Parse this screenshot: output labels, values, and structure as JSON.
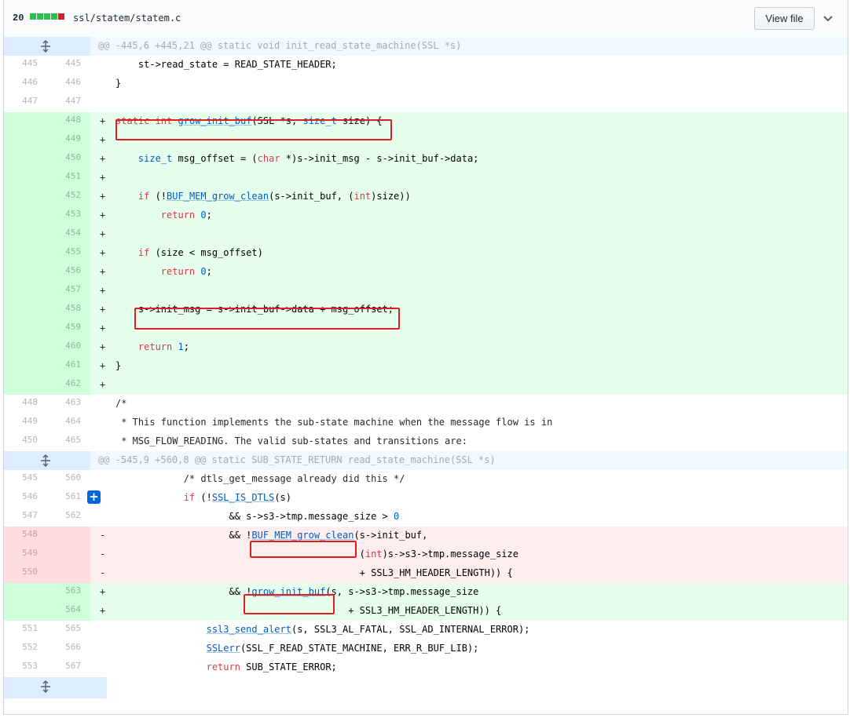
{
  "file": {
    "changes_count": "20",
    "diffstat_colors": [
      "#2cbe4e",
      "#2cbe4e",
      "#2cbe4e",
      "#2cbe4e",
      "#cb2431"
    ],
    "path": "ssl/statem/statem.c",
    "view_file_label": "View file",
    "collapse_icon": "chevron-down-icon",
    "expand_icon": "unfold-icon"
  },
  "hunks": [
    "@@ -445,6 +445,21 @@ static void init_read_state_machine(SSL *s)",
    "@@ -545,9 +560,8 @@ static SUB_STATE_RETURN read_state_machine(SSL *s)"
  ],
  "lines": [
    {
      "o": "445",
      "n": "445",
      "m": " ",
      "c": "    st->read_state = READ_STATE_HEADER;"
    },
    {
      "o": "446",
      "n": "446",
      "m": " ",
      "c": "}"
    },
    {
      "o": "447",
      "n": "447",
      "m": " ",
      "c": ""
    },
    {
      "o": "",
      "n": "448",
      "m": "+",
      "c": "static int grow_init_buf(SSL *s, size_t size) {"
    },
    {
      "o": "",
      "n": "449",
      "m": "+",
      "c": ""
    },
    {
      "o": "",
      "n": "450",
      "m": "+",
      "c": "    size_t msg_offset = (char *)s->init_msg - s->init_buf->data;"
    },
    {
      "o": "",
      "n": "451",
      "m": "+",
      "c": ""
    },
    {
      "o": "",
      "n": "452",
      "m": "+",
      "c": "    if (!BUF_MEM_grow_clean(s->init_buf, (int)size))"
    },
    {
      "o": "",
      "n": "453",
      "m": "+",
      "c": "        return 0;"
    },
    {
      "o": "",
      "n": "454",
      "m": "+",
      "c": ""
    },
    {
      "o": "",
      "n": "455",
      "m": "+",
      "c": "    if (size < msg_offset)"
    },
    {
      "o": "",
      "n": "456",
      "m": "+",
      "c": "        return 0;"
    },
    {
      "o": "",
      "n": "457",
      "m": "+",
      "c": ""
    },
    {
      "o": "",
      "n": "458",
      "m": "+",
      "c": "    s->init_msg = s->init_buf->data + msg_offset;"
    },
    {
      "o": "",
      "n": "459",
      "m": "+",
      "c": ""
    },
    {
      "o": "",
      "n": "460",
      "m": "+",
      "c": "    return 1;"
    },
    {
      "o": "",
      "n": "461",
      "m": "+",
      "c": "}"
    },
    {
      "o": "",
      "n": "462",
      "m": "+",
      "c": ""
    },
    {
      "o": "448",
      "n": "463",
      "m": " ",
      "c": "/*"
    },
    {
      "o": "449",
      "n": "464",
      "m": " ",
      "c": " * This function implements the sub-state machine when the message flow is in"
    },
    {
      "o": "450",
      "n": "465",
      "m": " ",
      "c": " * MSG_FLOW_READING. The valid sub-states and transitions are:"
    },
    {
      "o": "545",
      "n": "560",
      "m": " ",
      "c": "            /* dtls_get_message already did this */"
    },
    {
      "o": "546",
      "n": "561",
      "m": " ",
      "c": "            if (!SSL_IS_DTLS(s)"
    },
    {
      "o": "547",
      "n": "562",
      "m": " ",
      "c": "                    && s->s3->tmp.message_size > 0"
    },
    {
      "o": "548",
      "n": "",
      "m": "-",
      "c": "                    && !BUF_MEM_grow_clean(s->init_buf,"
    },
    {
      "o": "549",
      "n": "",
      "m": "-",
      "c": "                                           (int)s->s3->tmp.message_size"
    },
    {
      "o": "550",
      "n": "",
      "m": "-",
      "c": "                                           + SSL3_HM_HEADER_LENGTH)) {"
    },
    {
      "o": "",
      "n": "563",
      "m": "+",
      "c": "                    && !grow_init_buf(s, s->s3->tmp.message_size"
    },
    {
      "o": "",
      "n": "564",
      "m": "+",
      "c": "                                         + SSL3_HM_HEADER_LENGTH)) {"
    },
    {
      "o": "551",
      "n": "565",
      "m": " ",
      "c": "                ssl3_send_alert(s, SSL3_AL_FATAL, SSL_AD_INTERNAL_ERROR);"
    },
    {
      "o": "552",
      "n": "566",
      "m": " ",
      "c": "                SSLerr(SSL_F_READ_STATE_MACHINE, ERR_R_BUF_LIB);"
    },
    {
      "o": "553",
      "n": "567",
      "m": " ",
      "c": "                return SUB_STATE_ERROR;"
    }
  ],
  "add_comment_button": "+",
  "highlight_color": "#e02020"
}
